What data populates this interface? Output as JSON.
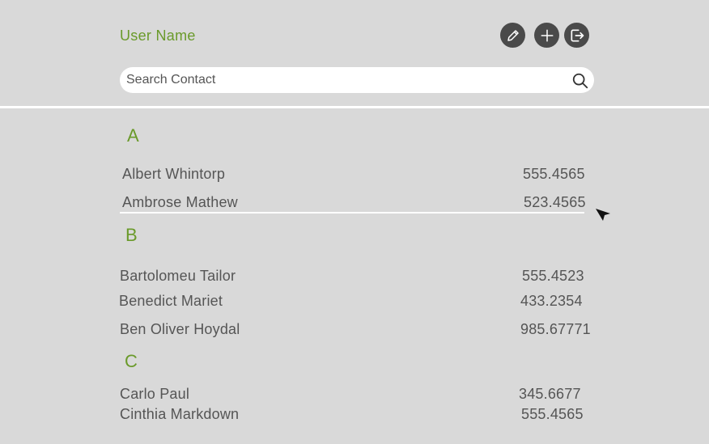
{
  "header": {
    "user_name": "User Name",
    "actions": [
      {
        "name": "edit",
        "icon": "pencil-icon"
      },
      {
        "name": "add",
        "icon": "plus-icon"
      },
      {
        "name": "logout",
        "icon": "logout-icon"
      }
    ]
  },
  "search": {
    "placeholder": "Search Contact",
    "icon": "magnifier-icon"
  },
  "colors": {
    "accent": "#6a9a2a",
    "background": "#d9d9d9",
    "icon_button": "#4a4a4a",
    "text": "#555555"
  },
  "contacts": {
    "groups": [
      {
        "letter": "A",
        "items": [
          {
            "name": "Albert Whintorp",
            "phone": "555.4565"
          },
          {
            "name": "Ambrose Mathew",
            "phone": "523.4565"
          }
        ]
      },
      {
        "letter": "B",
        "items": [
          {
            "name": "Bartolomeu Tailor",
            "phone": "555.4523"
          },
          {
            "name": "Benedict Mariet",
            "phone": "433.2354"
          },
          {
            "name": "Ben Oliver Hoydal",
            "phone": "985.67771"
          }
        ]
      },
      {
        "letter": "C",
        "items": [
          {
            "name": "Carlo Paul",
            "phone": "345.6677"
          },
          {
            "name": "Cinthia Markdown",
            "phone": "555.4565"
          }
        ]
      }
    ]
  }
}
